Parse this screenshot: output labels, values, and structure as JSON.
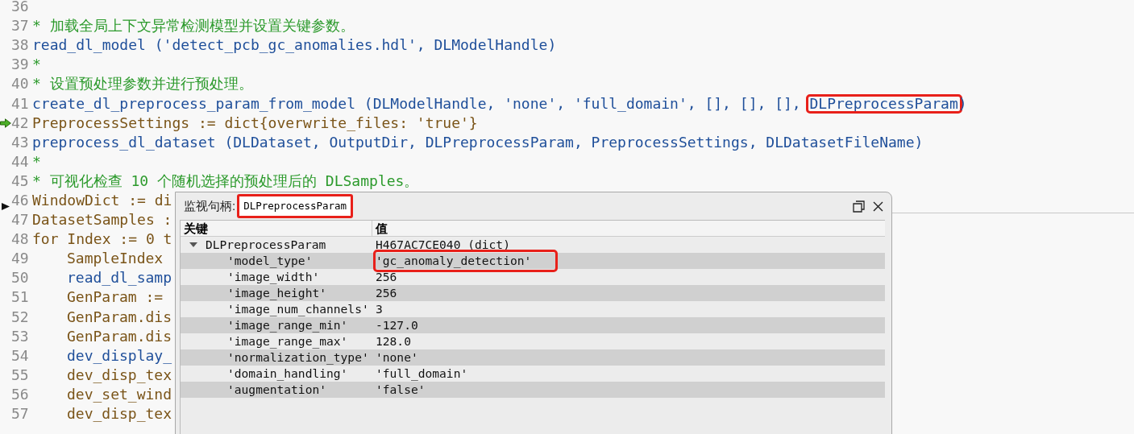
{
  "code_lines": [
    {
      "number": "36",
      "current": false,
      "pointer": false
    },
    {
      "number": "37",
      "current": false,
      "pointer": false,
      "segments": [
        {
          "kind": "comment",
          "text": "* 加载全局上下文异常检测模型并设置关键参数。"
        }
      ]
    },
    {
      "number": "38",
      "current": false,
      "pointer": false,
      "segments": [
        {
          "kind": "op",
          "text": "read_dl_model ('detect_pcb_gc_anomalies.hdl', DLModelHandle)"
        }
      ]
    },
    {
      "number": "39",
      "current": false,
      "pointer": false,
      "segments": [
        {
          "kind": "comment",
          "text": "*"
        }
      ]
    },
    {
      "number": "40",
      "current": false,
      "pointer": false,
      "segments": [
        {
          "kind": "comment",
          "text": "* 设置预处理参数并进行预处理。"
        }
      ]
    },
    {
      "number": "41",
      "current": false,
      "pointer": false,
      "segments": [
        {
          "kind": "op",
          "text": "create_dl_preprocess_param_from_model (DLModelHandle, 'none', 'full_domain', [], [], [], "
        },
        {
          "kind": "op",
          "text": "DLPreprocessParam",
          "highlighted": true
        },
        {
          "kind": "op",
          "text": ")"
        }
      ]
    },
    {
      "number": "42",
      "current": true,
      "pointer": false,
      "segments": [
        {
          "kind": "plain",
          "text": "PreprocessSettings := dict{overwrite_files: 'true'}"
        }
      ]
    },
    {
      "number": "43",
      "current": false,
      "pointer": false,
      "segments": [
        {
          "kind": "op",
          "text": "preprocess_dl_dataset (DLDataset, OutputDir, DLPreprocessParam, PreprocessSettings, DLDatasetFileName)"
        }
      ]
    },
    {
      "number": "44",
      "current": false,
      "pointer": false,
      "segments": [
        {
          "kind": "comment",
          "text": "*"
        }
      ]
    },
    {
      "number": "45",
      "current": false,
      "pointer": false,
      "segments": [
        {
          "kind": "comment",
          "text": "* 可视化检查 10 个随机选择的预处理后的 DLSamples。"
        }
      ]
    },
    {
      "number": "46",
      "current": false,
      "pointer": true,
      "segments": [
        {
          "kind": "plain",
          "text": "WindowDict := di"
        }
      ]
    },
    {
      "number": "47",
      "current": false,
      "pointer": false,
      "segments": [
        {
          "kind": "plain",
          "text": "DatasetSamples :"
        }
      ]
    },
    {
      "number": "48",
      "current": false,
      "pointer": false,
      "segments": [
        {
          "kind": "plain",
          "text": "for Index := 0 t"
        }
      ],
      "children": [
        {
          "number": "49",
          "current": false,
          "pointer": false,
          "segments": [
            {
              "kind": "plain",
              "text": "SampleIndex"
            }
          ]
        },
        {
          "number": "50",
          "current": false,
          "pointer": false,
          "segments": [
            {
              "kind": "op",
              "text": "read_dl_samp"
            }
          ]
        },
        {
          "number": "51",
          "current": false,
          "pointer": false,
          "segments": [
            {
              "kind": "plain",
              "text": "GenParam :="
            }
          ]
        },
        {
          "number": "52",
          "current": false,
          "pointer": false,
          "segments": [
            {
              "kind": "plain",
              "text": "GenParam.dis"
            }
          ]
        },
        {
          "number": "53",
          "current": false,
          "pointer": false,
          "segments": [
            {
              "kind": "plain",
              "text": "GenParam.dis"
            }
          ]
        },
        {
          "number": "54",
          "current": false,
          "pointer": false,
          "segments": [
            {
              "kind": "op",
              "text": "dev_display_"
            }
          ]
        },
        {
          "number": "55",
          "current": false,
          "pointer": false,
          "segments": [
            {
              "kind": "plain",
              "text": "dev_disp_tex"
            }
          ]
        },
        {
          "number": "56",
          "current": false,
          "pointer": false,
          "segments": [
            {
              "kind": "plain",
              "text": "dev_set_wind"
            }
          ]
        },
        {
          "number": "57",
          "current": false,
          "pointer": false,
          "segments": [
            {
              "kind": "plain",
              "text": "dev_disp_tex"
            }
          ]
        }
      ]
    }
  ],
  "watch_window": {
    "label": "监视句柄:",
    "handle": "DLPreprocessParam",
    "handle_highlighted": true,
    "columns": [
      "关键",
      "值"
    ],
    "root": {
      "key": "DLPreprocessParam",
      "value": "H467AC7CE040 (dict)",
      "expanded": true,
      "children": [
        {
          "key": "'model_type'",
          "value": "'gc_anomaly_detection'",
          "highlighted": true
        },
        {
          "key": "'image_width'",
          "value": "256",
          "highlighted": false
        },
        {
          "key": "'image_height'",
          "value": "256",
          "highlighted": false
        },
        {
          "key": "'image_num_channels'",
          "value": "3",
          "highlighted": false
        },
        {
          "key": "'image_range_min'",
          "value": "-127.0",
          "highlighted": false
        },
        {
          "key": "'image_range_max'",
          "value": "128.0",
          "highlighted": false
        },
        {
          "key": "'normalization_type'",
          "value": "'none'",
          "highlighted": false
        },
        {
          "key": "'domain_handling'",
          "value": "'full_domain'",
          "highlighted": false
        },
        {
          "key": "'augmentation'",
          "value": "'false'",
          "highlighted": false
        }
      ]
    }
  }
}
